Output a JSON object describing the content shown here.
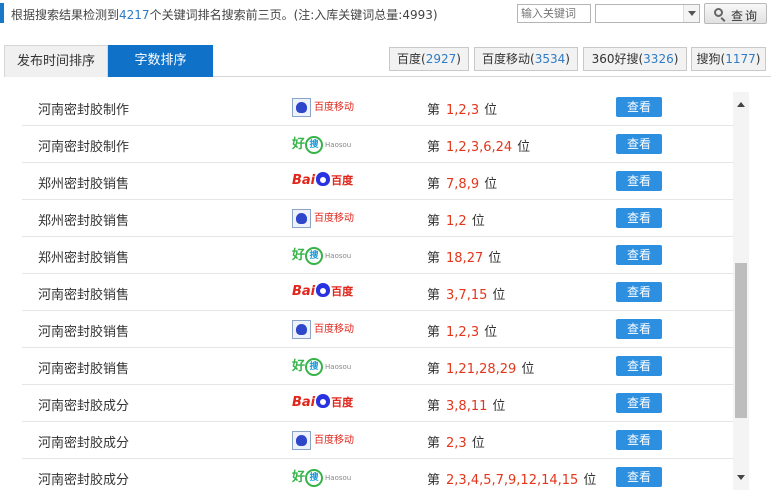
{
  "summary": {
    "prefix": "根据搜索结果检测到",
    "count": "4217",
    "suffix": "个关键词排名搜索前三页。(注:入库关键词总量:4993)"
  },
  "search": {
    "placeholder": "输入关键词",
    "select_value": "",
    "button_label": "查询"
  },
  "tabs": [
    {
      "label": "发布时间排序",
      "active": false
    },
    {
      "label": "字数排序",
      "active": true
    }
  ],
  "engines": [
    {
      "name": "百度",
      "count": "2927"
    },
    {
      "name": "百度移动",
      "count": "3534"
    },
    {
      "name": "360好搜",
      "count": "3326"
    },
    {
      "name": "搜狗",
      "count": "1177"
    }
  ],
  "logos": {
    "baidu": {
      "bai": "Bai",
      "du": "百度"
    },
    "baidu_mobile": {
      "text": "百度移动"
    },
    "haosou": {
      "hao": "好",
      "sou": "搜",
      "en": "Haosou"
    }
  },
  "rank_prefix": "第",
  "rank_suffix": "位",
  "view_label": "查看",
  "rows": [
    {
      "keyword": "河南密封胶制作",
      "engine": "baidu_mobile",
      "positions": "1,2,3"
    },
    {
      "keyword": "河南密封胶制作",
      "engine": "haosou",
      "positions": "1,2,3,6,24"
    },
    {
      "keyword": "郑州密封胶销售",
      "engine": "baidu",
      "positions": "7,8,9"
    },
    {
      "keyword": "郑州密封胶销售",
      "engine": "baidu_mobile",
      "positions": "1,2"
    },
    {
      "keyword": "郑州密封胶销售",
      "engine": "haosou",
      "positions": "18,27"
    },
    {
      "keyword": "河南密封胶销售",
      "engine": "baidu",
      "positions": "3,7,15"
    },
    {
      "keyword": "河南密封胶销售",
      "engine": "baidu_mobile",
      "positions": "1,2,3"
    },
    {
      "keyword": "河南密封胶销售",
      "engine": "haosou",
      "positions": "1,21,28,29"
    },
    {
      "keyword": "河南密封胶成分",
      "engine": "baidu",
      "positions": "3,8,11"
    },
    {
      "keyword": "河南密封胶成分",
      "engine": "baidu_mobile",
      "positions": "2,3"
    },
    {
      "keyword": "河南密封胶成分",
      "engine": "haosou",
      "positions": "2,3,4,5,7,9,12,14,15"
    }
  ]
}
